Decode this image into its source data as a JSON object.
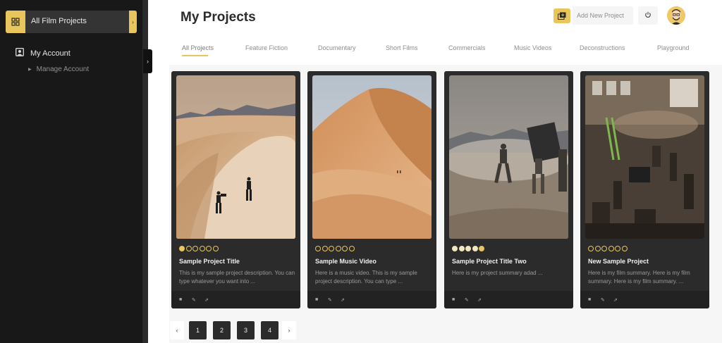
{
  "sidebar": {
    "active_item": {
      "label": "All Film Projects",
      "icon": "grid-icon"
    },
    "account": {
      "label": "My Account",
      "icon": "user-icon"
    },
    "sub_items": [
      {
        "label": "Manage Account"
      }
    ]
  },
  "header": {
    "title": "My Projects",
    "add_project_label": "Add New Project"
  },
  "tabs": [
    {
      "label": "All Projects",
      "active": true
    },
    {
      "label": "Feature Fiction"
    },
    {
      "label": "Documentary"
    },
    {
      "label": "Short Films"
    },
    {
      "label": "Commercials"
    },
    {
      "label": "Music Videos"
    },
    {
      "label": "Deconstructions"
    },
    {
      "label": "Playground"
    }
  ],
  "projects": [
    {
      "title": "Sample Project Title",
      "description": "This is my sample project description. You can type whatever you want into ...",
      "rating": 0.5
    },
    {
      "title": "Sample Music Video",
      "description": "Here is a music video. This is my sample project description. You can type ...",
      "rating": 0
    },
    {
      "title": "Sample Project Title Two",
      "description": "Here is my project summary adad ...",
      "rating": 4.5
    },
    {
      "title": "New Sample Project",
      "description": "Here is my film summary. Here is my film summary. Here is my film summary. ...",
      "rating": 0
    }
  ],
  "pagination": {
    "prev": "‹",
    "next": "›",
    "pages": [
      "1",
      "2",
      "3",
      "4"
    ]
  },
  "colors": {
    "accent": "#e9c65b",
    "sidebar_bg": "#181818",
    "card_bg": "#2b2b2b"
  }
}
